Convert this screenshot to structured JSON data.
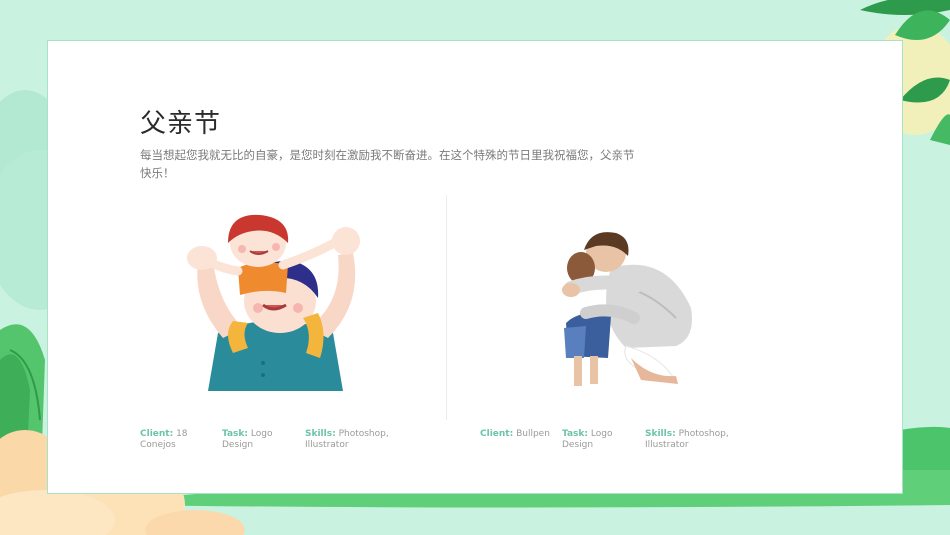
{
  "title": "父亲节",
  "description": "每当想起您我就无比的自豪，是您时刻在激励我不断奋进。在这个特殊的节日里我祝福您，父亲节快乐！",
  "items": [
    {
      "client_label": "Client:",
      "client_value": "18 Conejos",
      "task_label": "Task:",
      "task_value": "Logo Design",
      "skills_label": "Skills:",
      "skills_value": "Photoshop, Illustrator"
    },
    {
      "client_label": "Client:",
      "client_value": "Bullpen",
      "task_label": "Task:",
      "task_value": "Logo Design",
      "skills_label": "Skills:",
      "skills_value": "Photoshop, Illustrator"
    }
  ],
  "icons": [
    "father-child-shoulders-illustration",
    "father-hug-illustration",
    "leaf-decoration",
    "cloud-decoration"
  ],
  "colors": {
    "background": "#c9f3e0",
    "accent": "#6cc3ab",
    "grass": "#5fcf7a"
  }
}
